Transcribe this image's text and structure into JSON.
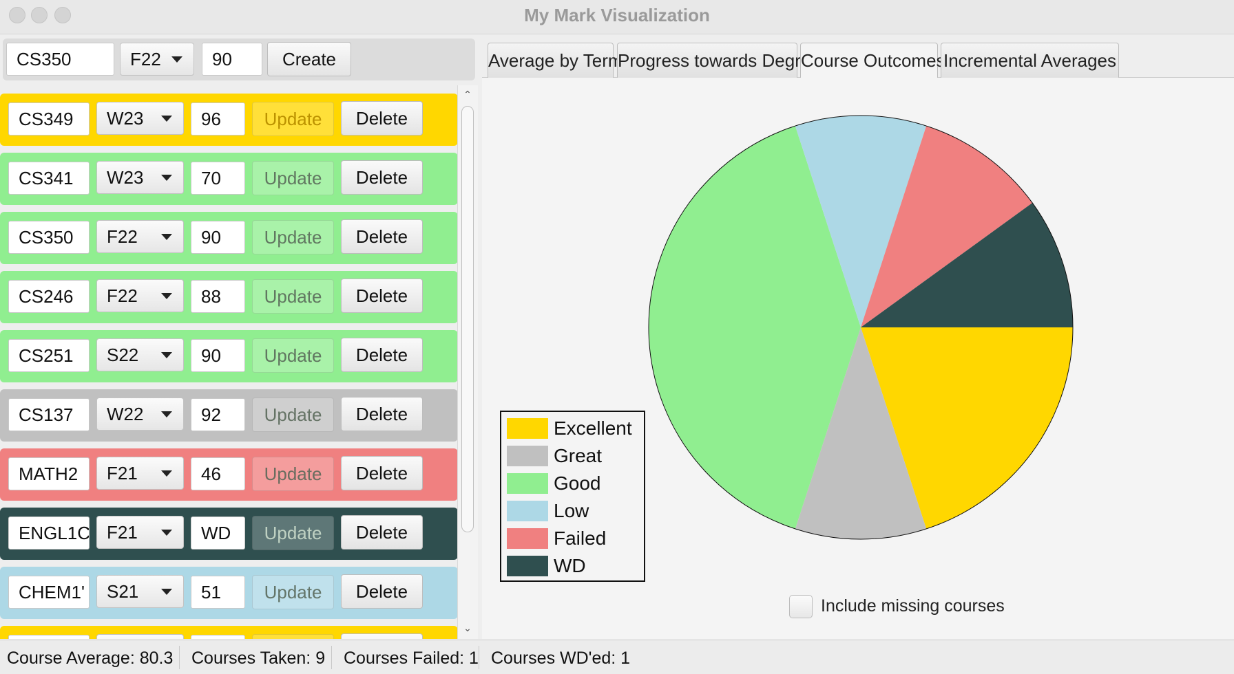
{
  "window": {
    "title": "My Mark Visualization"
  },
  "create": {
    "course": "CS350",
    "term": "F22",
    "mark": "90",
    "create_label": "Create"
  },
  "rows": [
    {
      "course": "CS349",
      "term": "W23",
      "mark": "96",
      "update": "Update",
      "delete": "Delete",
      "category": "Excellent",
      "color": "#ffd700"
    },
    {
      "course": "CS341",
      "term": "W23",
      "mark": "70",
      "update": "Update",
      "delete": "Delete",
      "category": "Good",
      "color": "#90ee90"
    },
    {
      "course": "CS350",
      "term": "F22",
      "mark": "90",
      "update": "Update",
      "delete": "Delete",
      "category": "Good",
      "color": "#90ee90"
    },
    {
      "course": "CS246",
      "term": "F22",
      "mark": "88",
      "update": "Update",
      "delete": "Delete",
      "category": "Good",
      "color": "#90ee90"
    },
    {
      "course": "CS251",
      "term": "S22",
      "mark": "90",
      "update": "Update",
      "delete": "Delete",
      "category": "Good",
      "color": "#90ee90"
    },
    {
      "course": "CS137",
      "term": "W22",
      "mark": "92",
      "update": "Update",
      "delete": "Delete",
      "category": "Great",
      "color": "#c0c0c0"
    },
    {
      "course": "MATH2",
      "term": "F21",
      "mark": "46",
      "update": "Update",
      "delete": "Delete",
      "category": "Failed",
      "color": "#f08080"
    },
    {
      "course": "ENGL1C",
      "term": "F21",
      "mark": "WD",
      "update": "Update",
      "delete": "Delete",
      "category": "WD",
      "color": "#2f4f4f"
    },
    {
      "course": "CHEM1'",
      "term": "S21",
      "mark": "51",
      "update": "Update",
      "delete": "Delete",
      "category": "Low",
      "color": "#add8e6"
    },
    {
      "course": "",
      "term": "",
      "mark": "",
      "update": "",
      "delete": "",
      "category": "Excellent",
      "color": "#ffd700"
    }
  ],
  "tabs": [
    {
      "label": "Average by Term"
    },
    {
      "label": "Progress towards Degree"
    },
    {
      "label": "Course Outcomes",
      "selected": true
    },
    {
      "label": "Incremental Averages"
    }
  ],
  "chart_data": {
    "type": "pie",
    "title": "",
    "slices": [
      {
        "label": "Excellent",
        "value": 2,
        "color": "#ffd700"
      },
      {
        "label": "Great",
        "value": 1,
        "color": "#c0c0c0"
      },
      {
        "label": "Good",
        "value": 4,
        "color": "#90ee90"
      },
      {
        "label": "Low",
        "value": 1,
        "color": "#add8e6"
      },
      {
        "label": "Failed",
        "value": 1,
        "color": "#f08080"
      },
      {
        "label": "WD",
        "value": 1,
        "color": "#2f4f4f"
      }
    ],
    "legend_placement": "bottom-left"
  },
  "include_missing": {
    "label": "Include missing courses",
    "checked": false
  },
  "status": {
    "average": "Course Average: 80.3",
    "taken": "Courses Taken: 9",
    "failed": "Courses Failed: 1",
    "wd": "Courses WD'ed: 1"
  }
}
